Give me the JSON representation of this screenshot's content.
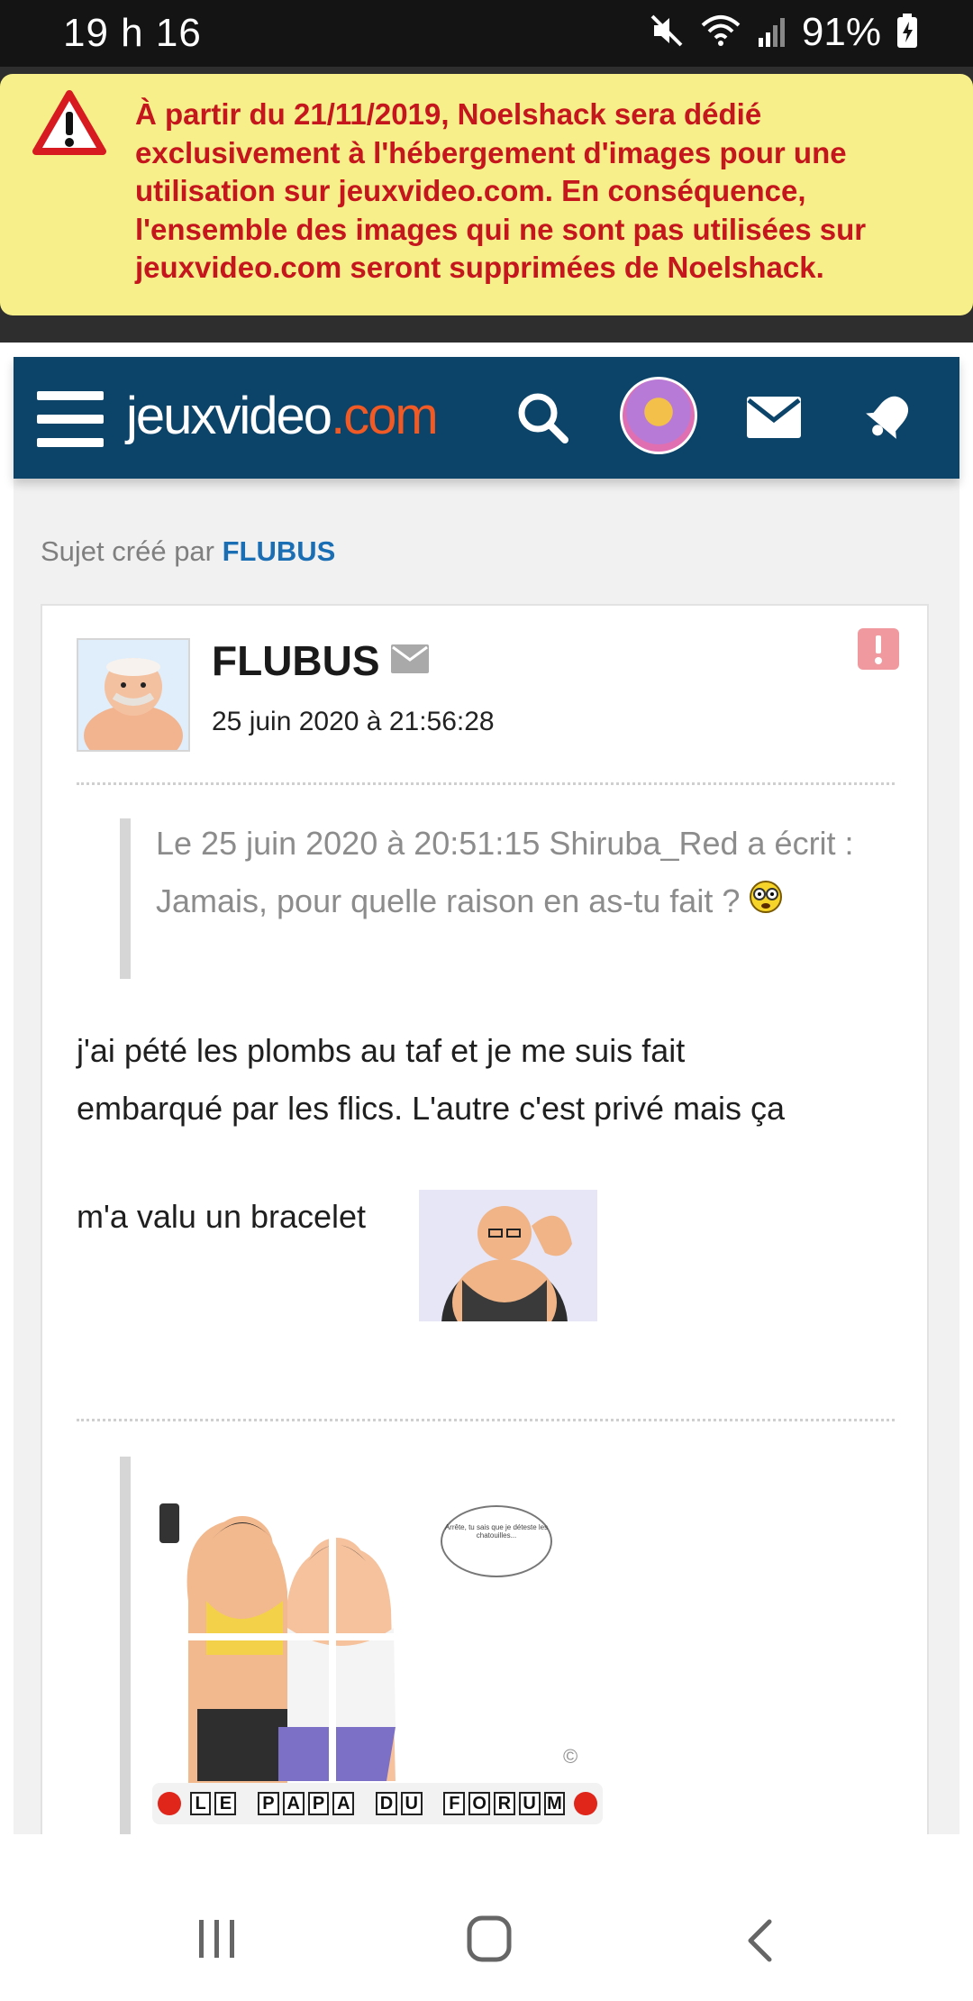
{
  "status_bar": {
    "time": "19 h 16",
    "battery": "91%",
    "icons": [
      "mute-icon",
      "wifi-icon",
      "signal-icon",
      "battery-charging-icon"
    ]
  },
  "banner": {
    "icon": "warning-icon",
    "text": "À partir du 21/11/2019, Noelshack sera dédié exclusivement à l'hébergement d'images pour une utilisation sur jeuxvideo.com. En conséquence, l'ensemble des images qui ne sont pas utilisées sur jeuxvideo.com seront supprimées de Noelshack.",
    "text_color": "#c4161c",
    "background": "#f7ef8a"
  },
  "navbar": {
    "logo_main": "jeuxvideo",
    "logo_domain": ".com",
    "background": "#0c4469",
    "accent": "#f15a24",
    "icons": [
      "menu-icon",
      "search-icon",
      "user-avatar",
      "mail-icon",
      "notification-bell-icon"
    ]
  },
  "topic": {
    "created_by_label": "Sujet créé par",
    "author": "FLUBUS"
  },
  "post": {
    "author": "FLUBUS",
    "date": "25 juin 2020 à 21:56:28",
    "quote": {
      "header": "Le 25 juin 2020 à 20:51:15 Shiruba_Red a écrit :",
      "text": "Jamais, pour quelle raison en as-tu fait ?"
    },
    "body_line_1": "j'ai pété les plombs au taf et je me suis fait",
    "body_line_2": "embarqué par les flics. L'autre c'est privé mais ça",
    "body_line_3": "m'a valu un bracelet",
    "signature": {
      "caption_letters": [
        "L",
        "E",
        " ",
        "P",
        "A",
        "P",
        "A",
        " ",
        "D",
        "U",
        " ",
        "F",
        "O",
        "R",
        "U",
        "M"
      ],
      "bubble_text": "Arrête, tu sais que je déteste les chatouilles...",
      "copyright": "©"
    }
  },
  "android_nav": {
    "icons": [
      "recent-apps-icon",
      "home-icon",
      "back-icon"
    ]
  }
}
